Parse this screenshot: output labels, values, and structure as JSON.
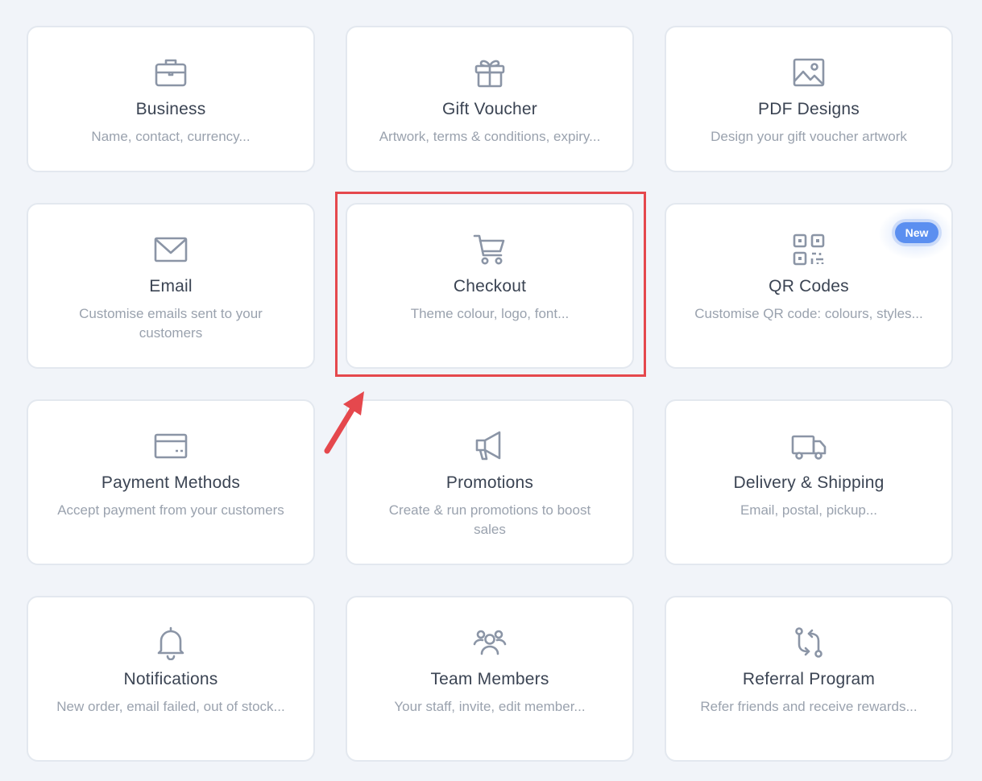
{
  "cards": [
    {
      "title": "Business",
      "desc": "Name, contact, currency...",
      "icon": "briefcase-icon"
    },
    {
      "title": "Gift Voucher",
      "desc": "Artwork, terms & conditions, expiry...",
      "icon": "gift-icon"
    },
    {
      "title": "PDF Designs",
      "desc": "Design your gift voucher artwork",
      "icon": "image-icon"
    },
    {
      "title": "Email",
      "desc": "Customise emails sent to your customers",
      "icon": "envelope-icon"
    },
    {
      "title": "Checkout",
      "desc": "Theme colour, logo, font...",
      "icon": "cart-icon"
    },
    {
      "title": "QR Codes",
      "desc": "Customise QR code: colours, styles...",
      "icon": "qr-code-icon",
      "badge": "New"
    },
    {
      "title": "Payment Methods",
      "desc": "Accept payment from your customers",
      "icon": "credit-card-icon"
    },
    {
      "title": "Promotions",
      "desc": "Create & run promotions to boost sales",
      "icon": "megaphone-icon"
    },
    {
      "title": "Delivery & Shipping",
      "desc": "Email, postal, pickup...",
      "icon": "truck-icon"
    },
    {
      "title": "Notifications",
      "desc": "New order, email failed, out of stock...",
      "icon": "bell-icon"
    },
    {
      "title": "Team Members",
      "desc": "Your staff, invite, edit member...",
      "icon": "users-icon"
    },
    {
      "title": "Referral Program",
      "desc": "Refer friends and receive rewards...",
      "icon": "referral-arrows-icon"
    }
  ],
  "colors": {
    "background": "#f1f4f9",
    "card": "#ffffff",
    "icon": "#8b95a6",
    "title": "#3b4453",
    "description": "#9aa2ae",
    "badge": "#5b8ff0",
    "highlight": "#e5484d"
  }
}
